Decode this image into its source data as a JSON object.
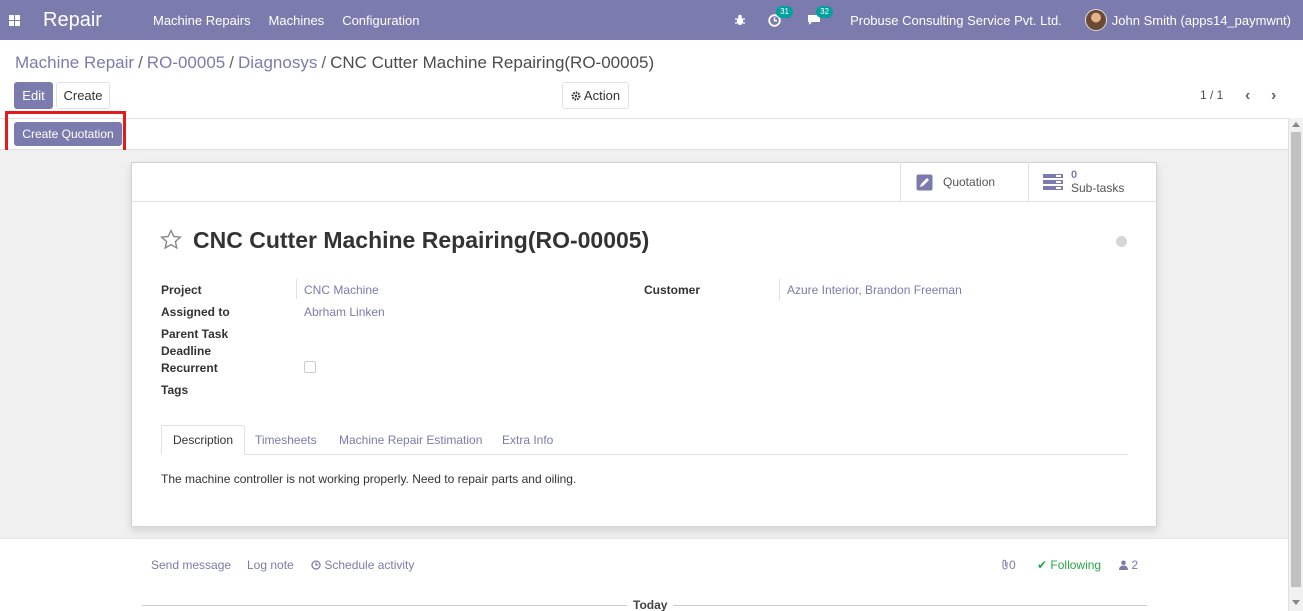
{
  "navbar": {
    "app_name": "Repair",
    "menu": [
      "Machine Repairs",
      "Machines",
      "Configuration"
    ],
    "activity_count": "31",
    "message_count": "32",
    "company": "Probuse Consulting Service Pvt. Ltd.",
    "user": "John Smith (apps14_paymwnt)"
  },
  "breadcrumb": {
    "items": [
      "Machine Repair",
      "RO-00005",
      "Diagnosys"
    ],
    "current": "CNC Cutter Machine Repairing(RO-00005)"
  },
  "toolbar": {
    "edit_label": "Edit",
    "create_label": "Create",
    "action_label": "Action",
    "pager": "1 / 1"
  },
  "header": {
    "create_quotation_label": "Create Quotation"
  },
  "button_box": {
    "quotation_label": "Quotation",
    "subtasks_count": "0",
    "subtasks_label": "Sub-tasks"
  },
  "form": {
    "title": "CNC Cutter Machine Repairing(RO-00005)",
    "fields": {
      "project_label": "Project",
      "project_value": "CNC Machine",
      "assigned_label": "Assigned to",
      "assigned_value": "Abrham Linken",
      "parent_task_label": "Parent Task",
      "deadline_label": "Deadline",
      "recurrent_label": "Recurrent",
      "tags_label": "Tags",
      "customer_label": "Customer",
      "customer_value": "Azure Interior, Brandon Freeman"
    },
    "tabs": [
      "Description",
      "Timesheets",
      "Machine Repair Estimation",
      "Extra Info"
    ],
    "description": "The machine controller is not working properly. Need to repair parts and oiling."
  },
  "chatter": {
    "send_message": "Send message",
    "log_note": "Log note",
    "schedule_activity": "Schedule activity",
    "attachments_count": "0",
    "following": "Following",
    "followers_count": "2",
    "today": "Today"
  },
  "colors": {
    "brand": "#7c7bad",
    "highlight": "#e31b1b",
    "following": "#28a745"
  }
}
